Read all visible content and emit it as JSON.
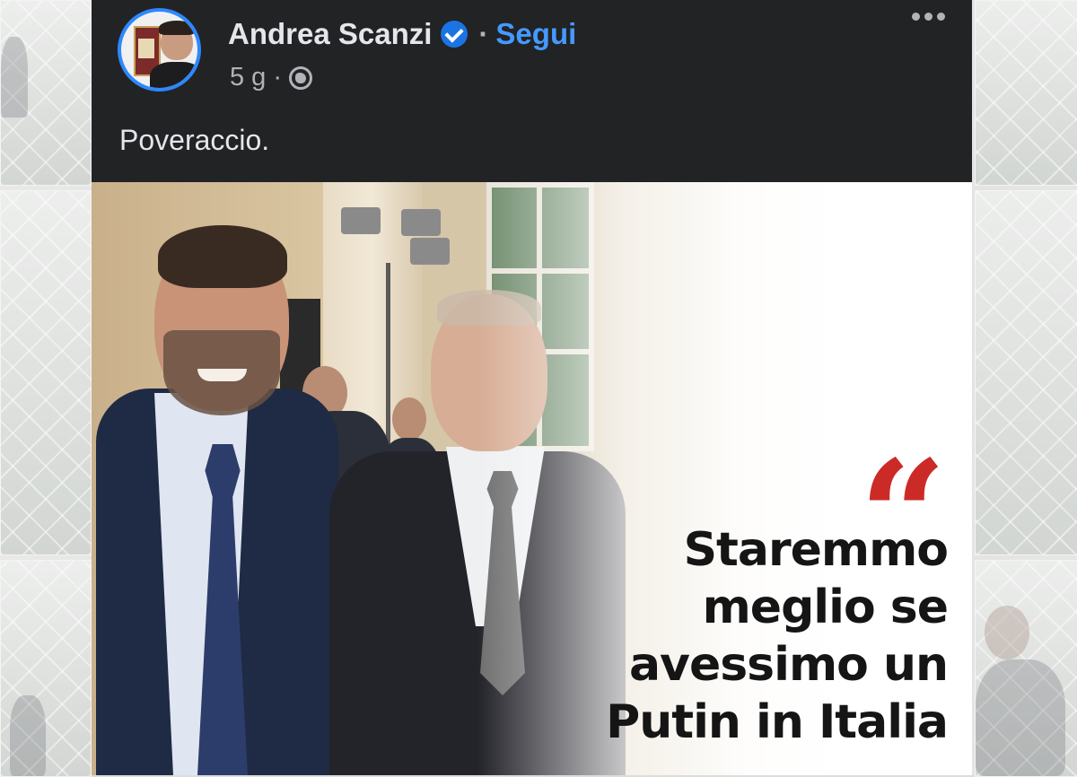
{
  "post": {
    "author": "Andrea Scanzi",
    "verified_icon": "verified-badge-icon",
    "separator": "·",
    "follow_label": "Segui",
    "timestamp": "5 g",
    "meta_separator": "·",
    "audience_icon": "globe-icon",
    "more_icon": "more-options-icon",
    "text": "Poveraccio."
  },
  "image": {
    "quote_mark": "“",
    "quote_lines": [
      "Staremmo",
      "meglio se",
      "avessimo un",
      "Putin in Italia"
    ]
  },
  "colors": {
    "header_bg": "#222325",
    "link_blue": "#4599ff",
    "avatar_ring": "#2d88ff",
    "quote_red": "#cc2a27"
  }
}
